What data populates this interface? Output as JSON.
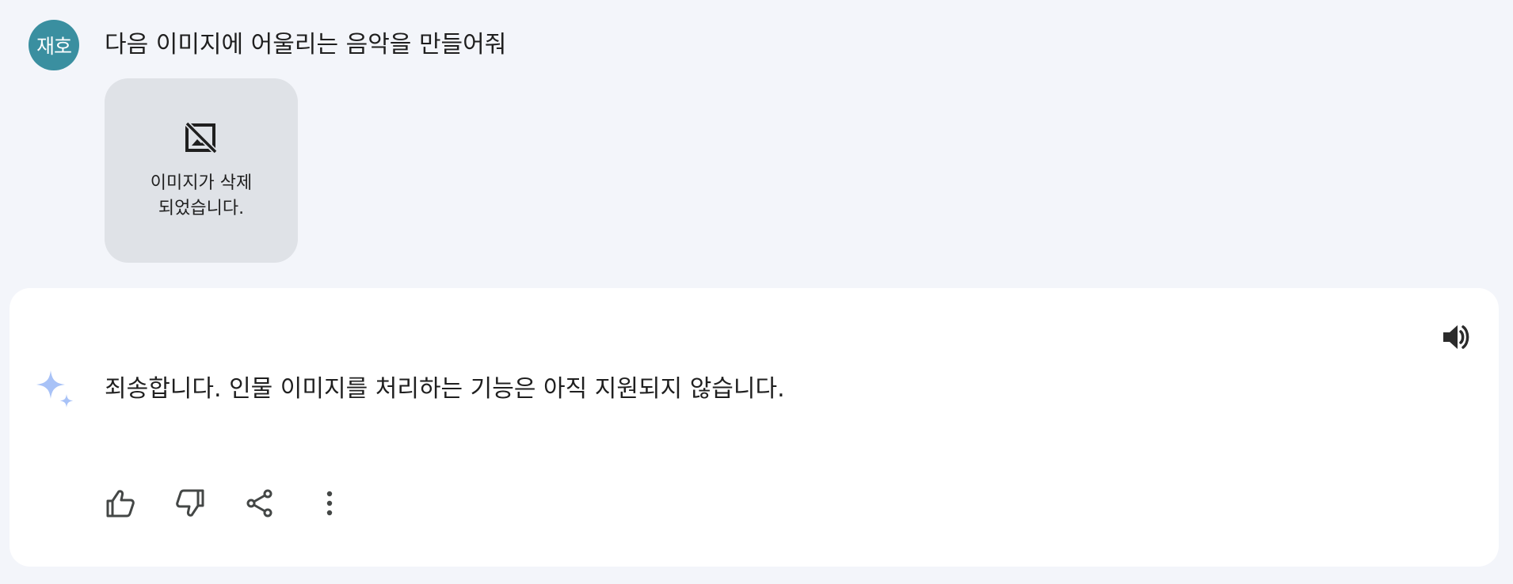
{
  "user": {
    "avatar_text": "재호",
    "avatar_color": "#3a8fa0",
    "message": "다음 이미지에 어울리는 음악을 만들어줘",
    "attachment": {
      "icon": "image-deleted-icon",
      "text": "이미지가 삭제 되었습니다."
    }
  },
  "response": {
    "icon": "sparkle-icon",
    "text": "죄송합니다. 인물 이미지를 처리하는 기능은 아직 지원되지 않습니다.",
    "speaker_icon": "volume-icon",
    "actions": [
      {
        "name": "thumbs-up-icon"
      },
      {
        "name": "thumbs-down-icon"
      },
      {
        "name": "share-icon"
      },
      {
        "name": "more-vert-icon"
      }
    ]
  },
  "colors": {
    "background": "#f3f5fa",
    "card": "#ffffff",
    "sparkle": "#a8c2f7",
    "icon": "#444746"
  }
}
